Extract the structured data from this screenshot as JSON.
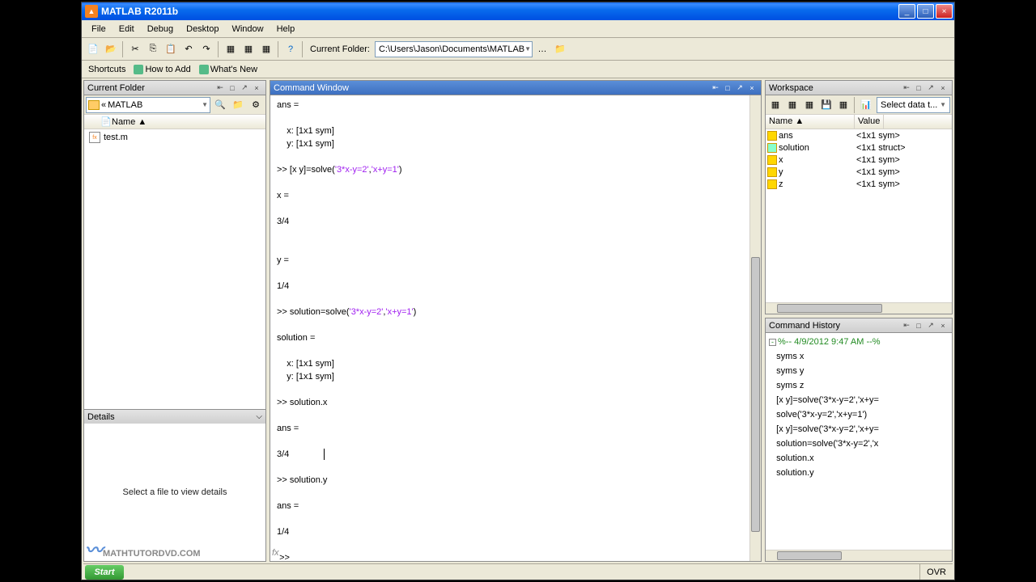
{
  "window": {
    "title": "MATLAB R2011b"
  },
  "menu": {
    "file": "File",
    "edit": "Edit",
    "debug": "Debug",
    "desktop": "Desktop",
    "window": "Window",
    "help": "Help"
  },
  "toolbar": {
    "current_folder_label": "Current Folder:",
    "current_folder_path": "C:\\Users\\Jason\\Documents\\MATLAB"
  },
  "shortcuts": {
    "label": "Shortcuts",
    "how_to_add": "How to Add",
    "whats_new": "What's New"
  },
  "current_folder": {
    "title": "Current Folder",
    "nav_back": "«",
    "nav_text": "MATLAB",
    "header_name": "Name ▲",
    "files": [
      {
        "name": "test.m"
      }
    ],
    "details_label": "Details",
    "details_msg": "Select a file to view details"
  },
  "command_window": {
    "title": "Command Window",
    "prompt_final": ">> "
  },
  "workspace": {
    "title": "Workspace",
    "select_data": "Select data t...",
    "col_name": "Name ▲",
    "col_value": "Value",
    "vars": [
      {
        "name": "ans",
        "value": "<1x1 sym>",
        "type": "sym"
      },
      {
        "name": "solution",
        "value": "<1x1 struct>",
        "type": "struct"
      },
      {
        "name": "x",
        "value": "<1x1 sym>",
        "type": "sym"
      },
      {
        "name": "y",
        "value": "<1x1 sym>",
        "type": "sym"
      },
      {
        "name": "z",
        "value": "<1x1 sym>",
        "type": "sym"
      }
    ]
  },
  "command_history": {
    "title": "Command History",
    "timestamp": "%-- 4/9/2012 9:47 AM --%",
    "items": [
      "syms x",
      "syms y",
      "syms z",
      "[x y]=solve('3*x-y=2','x+y=",
      "solve('3*x-y=2','x+y=1')",
      "[x y]=solve('3*x-y=2','x+y=",
      "solution=solve('3*x-y=2','x",
      "solution.x",
      "solution.y"
    ]
  },
  "status": {
    "start": "Start",
    "ovr": "OVR"
  },
  "watermark": "MATHTUTORDVD.COM"
}
